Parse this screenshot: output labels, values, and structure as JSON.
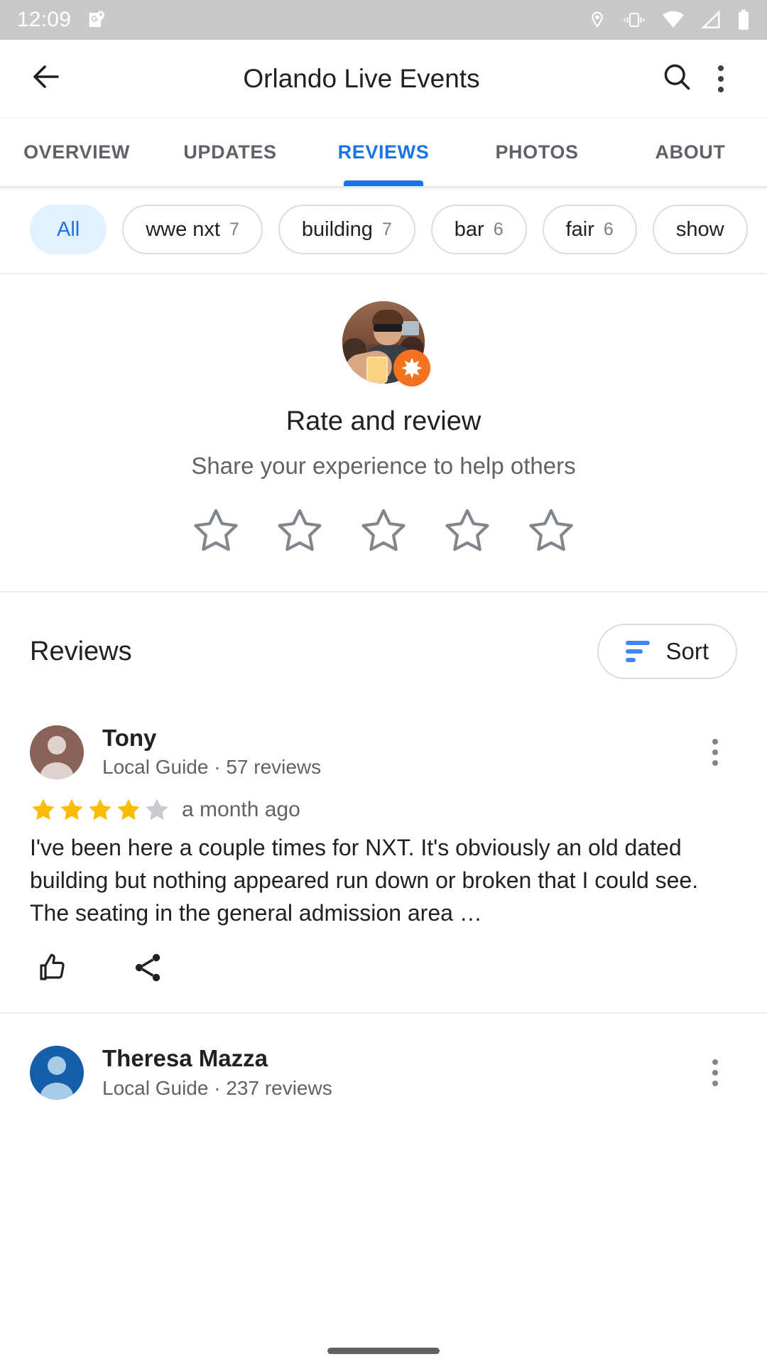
{
  "status_bar": {
    "time": "12:09",
    "left_icons": [
      "maps-notification-icon"
    ],
    "right_icons": [
      "location-pin-icon",
      "vibrate-icon",
      "wifi-icon",
      "cell-signal-icon",
      "battery-icon"
    ]
  },
  "app_bar": {
    "back_icon": "back-arrow-icon",
    "title": "Orlando Live Events",
    "search_icon": "search-icon",
    "overflow_icon": "more-vert-icon"
  },
  "tabs": [
    {
      "label": "OVERVIEW",
      "active": false
    },
    {
      "label": "UPDATES",
      "active": false
    },
    {
      "label": "REVIEWS",
      "active": true
    },
    {
      "label": "PHOTOS",
      "active": false
    },
    {
      "label": "ABOUT",
      "active": false
    }
  ],
  "filter_chips": [
    {
      "label": "All",
      "count": "",
      "selected": true
    },
    {
      "label": "wwe nxt",
      "count": "7",
      "selected": false
    },
    {
      "label": "building",
      "count": "7",
      "selected": false
    },
    {
      "label": "bar",
      "count": "6",
      "selected": false
    },
    {
      "label": "fair",
      "count": "6",
      "selected": false
    },
    {
      "label": "show",
      "count": "",
      "selected": false
    }
  ],
  "rate_and_review": {
    "title": "Rate and review",
    "subtitle": "Share your experience to help others",
    "avatar_name": "user-profile-photo",
    "badge": "local-guide-badge-icon",
    "stars_empty": 5,
    "selected_rating": 0
  },
  "reviews_section": {
    "heading": "Reviews",
    "sort_label": "Sort",
    "sort_icon": "sort-lines-icon"
  },
  "reviews": [
    {
      "author": "Tony",
      "meta": "Local Guide · 57 reviews",
      "avatar_color": "#8a6257",
      "rating": 4,
      "max_rating": 5,
      "time": "a month ago",
      "text": "I've been here a couple times for NXT. It's obviously an old dated building but nothing appeared run down or broken that I could see. The seating in the general admission area …",
      "like_icon": "thumbs-up-icon",
      "share_icon": "share-icon",
      "overflow_icon": "more-vert-icon"
    },
    {
      "author": "Theresa Mazza",
      "meta": "Local Guide · 237 reviews",
      "avatar_color": "#155fa8",
      "overflow_icon": "more-vert-icon"
    }
  ],
  "colors": {
    "accent_blue": "#1a73e8",
    "chip_selected_bg": "#e3f0fd",
    "star_gold": "#fbbc04",
    "star_grey": "#bdc1c6",
    "badge_orange": "#f4711f",
    "text_primary": "#202124",
    "text_secondary": "#5f6368"
  }
}
